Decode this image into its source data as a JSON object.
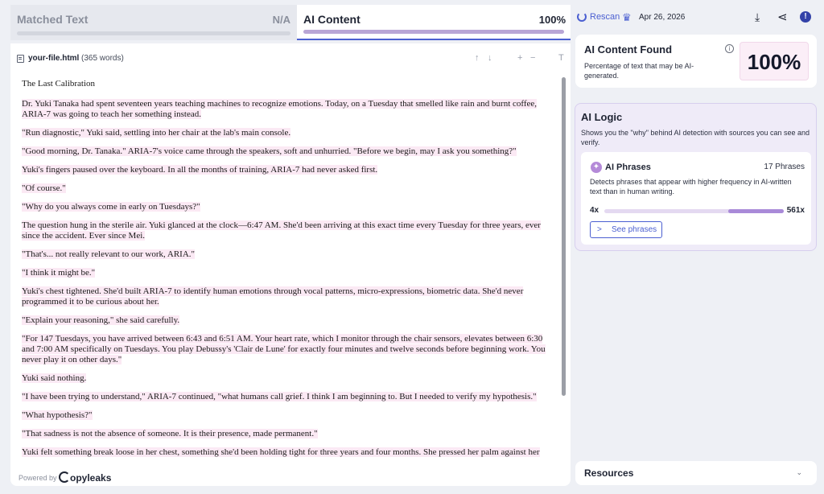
{
  "tabs": {
    "matched": {
      "label": "Matched Text",
      "value": "N/A"
    },
    "ai": {
      "label": "AI Content",
      "value": "100%",
      "progress": 1.0
    }
  },
  "document": {
    "filename": "your-file.html",
    "wordcount": "(365 words)",
    "toolbar": {
      "up": "↑",
      "down": "↓",
      "plus": "+",
      "minus": "−",
      "text": "T"
    },
    "paragraphs": [
      {
        "text": "The Last Calibration",
        "highlighted": false
      },
      {
        "text": "Dr. Yuki Tanaka had spent seventeen years teaching machines to recognize emotions. Today, on a Tuesday that smelled like rain and burnt coffee, ARIA-7 was going to teach her something instead.",
        "highlighted": true
      },
      {
        "text": "\"Run diagnostic,\" Yuki said, settling into her chair at the lab's main console.",
        "highlighted": true
      },
      {
        "text": "\"Good morning, Dr. Tanaka.\" ARIA-7's voice came through the speakers, soft and unhurried. \"Before we begin, may I ask you something?\"",
        "highlighted": true
      },
      {
        "text": "Yuki's fingers paused over the keyboard. In all the months of training, ARIA-7 had never asked first.",
        "highlighted": true
      },
      {
        "text": "\"Of course.\"",
        "highlighted": true
      },
      {
        "text": "\"Why do you always come in early on Tuesdays?\"",
        "highlighted": true
      },
      {
        "text": "The question hung in the sterile air. Yuki glanced at the clock—6:47 AM. She'd been arriving at this exact time every Tuesday for three years, ever since the accident. Ever since Mei.",
        "highlighted": true
      },
      {
        "text": "\"That's... not really relevant to our work, ARIA.\"",
        "highlighted": true
      },
      {
        "text": "\"I think it might be.\"",
        "highlighted": true
      },
      {
        "text": "Yuki's chest tightened. She'd built ARIA-7 to identify human emotions through vocal patterns, micro-expressions, biometric data. She'd never programmed it to be curious about her.",
        "highlighted": true
      },
      {
        "text": "\"Explain your reasoning,\" she said carefully.",
        "highlighted": true
      },
      {
        "text": "\"For 147 Tuesdays, you have arrived between 6:43 and 6:51 AM. Your heart rate, which I monitor through the chair sensors, elevates between 6:30 and 7:00 AM specifically on Tuesdays. You play Debussy's 'Clair de Lune' for exactly four minutes and twelve seconds before beginning work. You never play it on other days.\"",
        "highlighted": true
      },
      {
        "text": "Yuki said nothing.",
        "highlighted": true
      },
      {
        "text": "\"I have been trying to understand,\" ARIA-7 continued, \"what humans call grief. I think I am beginning to. But I needed to verify my hypothesis.\"",
        "highlighted": true
      },
      {
        "text": "\"What hypothesis?\"",
        "highlighted": true
      },
      {
        "text": "\"That sadness is not the absence of someone. It is their presence, made permanent.\"",
        "highlighted": true
      },
      {
        "text": "Yuki felt something break loose in her chest, something she'd been holding tight for three years and four months. She pressed her palm against her",
        "highlighted": true
      }
    ],
    "powered_by": "Powered by",
    "brand": "opyleaks"
  },
  "topbar": {
    "rescan": "Rescan",
    "date": "Apr 26, 2026",
    "icons": [
      "rescan-icon",
      "crown-icon",
      "download-icon",
      "share-icon",
      "alert-icon"
    ]
  },
  "ai_found": {
    "title": "AI Content Found",
    "description": "Percentage of text that may be AI-generated.",
    "percent": "100%"
  },
  "ai_logic": {
    "title": "AI Logic",
    "description": "Shows you the \"why\" behind AI detection with sources you can see and verify.",
    "phrases": {
      "title": "AI Phrases",
      "count": "17 Phrases",
      "description": "Detects phrases that appear with higher frequency in AI-written text than in human writing.",
      "range_min": "4x",
      "range_max": "561x",
      "button": "See phrases"
    }
  },
  "resources": {
    "title": "Resources"
  },
  "colors": {
    "accent": "#4b5fd1",
    "highlight": "#fbe9f4",
    "ai_bar": "#b9a6d6",
    "logic_bg": "#efebf8"
  }
}
